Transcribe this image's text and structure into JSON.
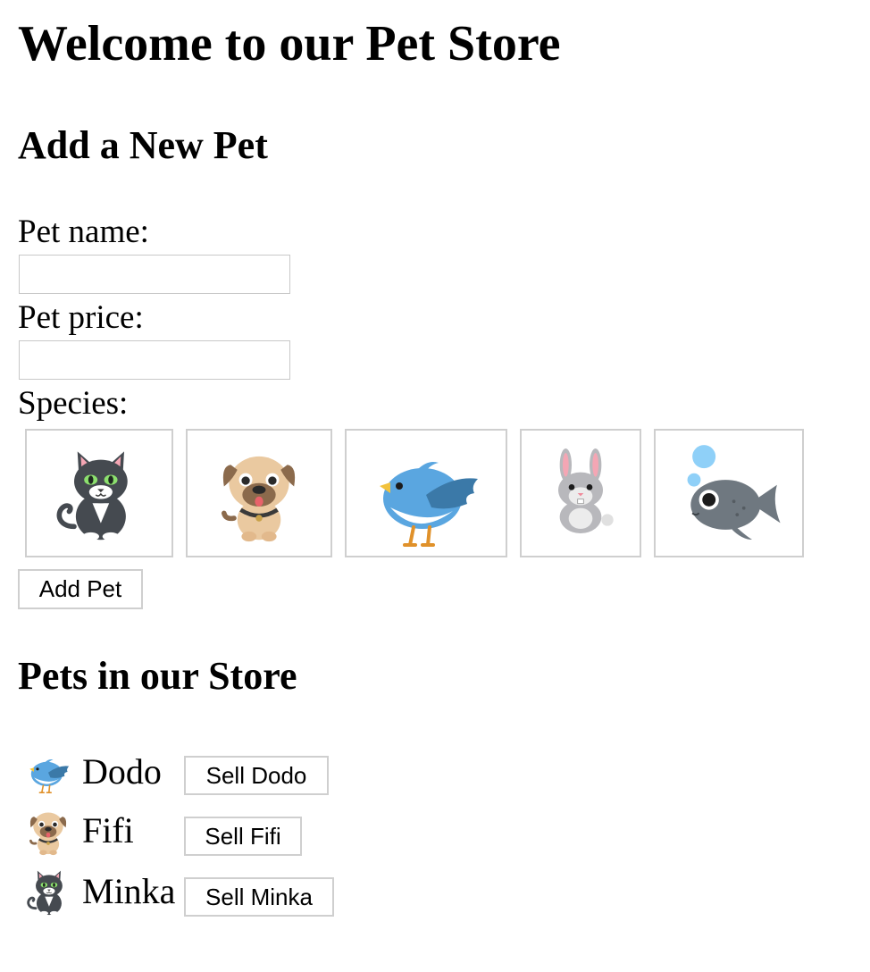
{
  "page": {
    "title": "Welcome to our Pet Store"
  },
  "add_pet": {
    "heading": "Add a New Pet",
    "name_label": "Pet name:",
    "name_value": "",
    "price_label": "Pet price:",
    "price_value": "",
    "species_label": "Species:",
    "species": [
      {
        "icon": "cat-icon"
      },
      {
        "icon": "dog-icon"
      },
      {
        "icon": "bird-icon"
      },
      {
        "icon": "rabbit-icon"
      },
      {
        "icon": "fish-icon"
      }
    ],
    "submit_label": "Add Pet"
  },
  "store": {
    "heading": "Pets in our Store",
    "pets": [
      {
        "name": "Dodo",
        "icon": "bird-icon",
        "sell_label": "Sell Dodo"
      },
      {
        "name": "Fifi",
        "icon": "dog-icon",
        "sell_label": "Sell Fifi"
      },
      {
        "name": "Minka",
        "icon": "cat-icon",
        "sell_label": "Sell Minka"
      }
    ]
  },
  "colors": {
    "border": "#cfcfcf",
    "cat_body": "#454a50",
    "cat_eye": "#8ce06e",
    "dog_body": "#eac9a0",
    "dog_ear": "#8b6a4c",
    "bird_body": "#5aa6e0",
    "rabbit_body": "#b8b8bc",
    "fish_body": "#6f7880",
    "bubble": "#8fd0f8"
  }
}
